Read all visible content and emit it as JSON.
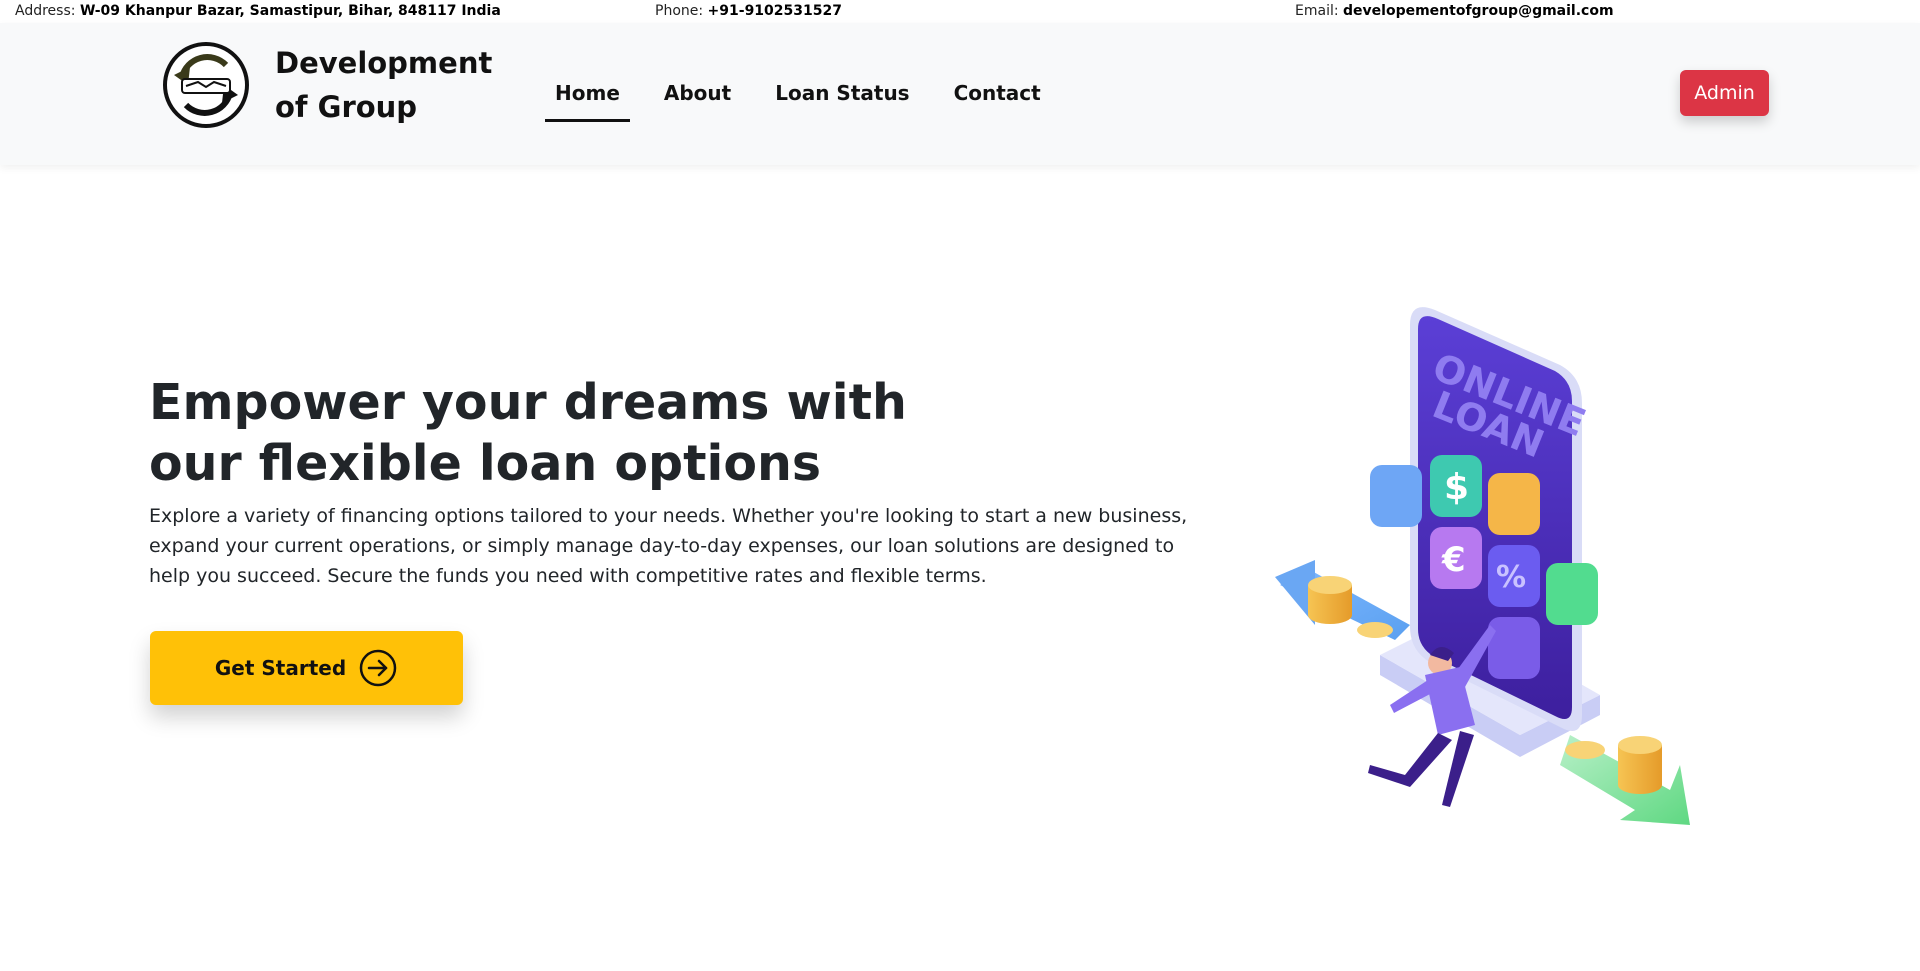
{
  "topbar": {
    "address_label": "Address:",
    "address_value": "W-09 Khanpur Bazar, Samastipur, Bihar, 848117 India",
    "phone_label": "Phone:",
    "phone_value": "+91-9102531527",
    "email_label": "Email:",
    "email_value": "developementofgroup@gmail.com"
  },
  "header": {
    "logo_icon": "handshake-arrows-icon",
    "brand_line1": "Development",
    "brand_line2": "of Group",
    "nav": [
      {
        "label": "Home",
        "active": true
      },
      {
        "label": "About",
        "active": false
      },
      {
        "label": "Loan Status",
        "active": false
      },
      {
        "label": "Contact",
        "active": false
      }
    ],
    "admin_label": "Admin"
  },
  "hero": {
    "title_line1": "Empower your dreams with",
    "title_line2": "our flexible loan options",
    "description": "Explore a variety of financing options tailored to your needs. Whether you're looking to start a new business, expand your current operations, or simply manage day-to-day expenses, our loan solutions are designed to help you succeed. Secure the funds you need with competitive rates and flexible terms.",
    "cta_label": "Get Started",
    "cta_icon": "arrow-right-circle-icon",
    "illustration_text_line1": "ONLINE",
    "illustration_text_line2": "LOAN",
    "illustration_icon": "online-loan-illustration"
  },
  "colors": {
    "admin_button": "#dc3545",
    "cta_button": "#ffc107",
    "navbar_bg": "#f8f9fa"
  }
}
